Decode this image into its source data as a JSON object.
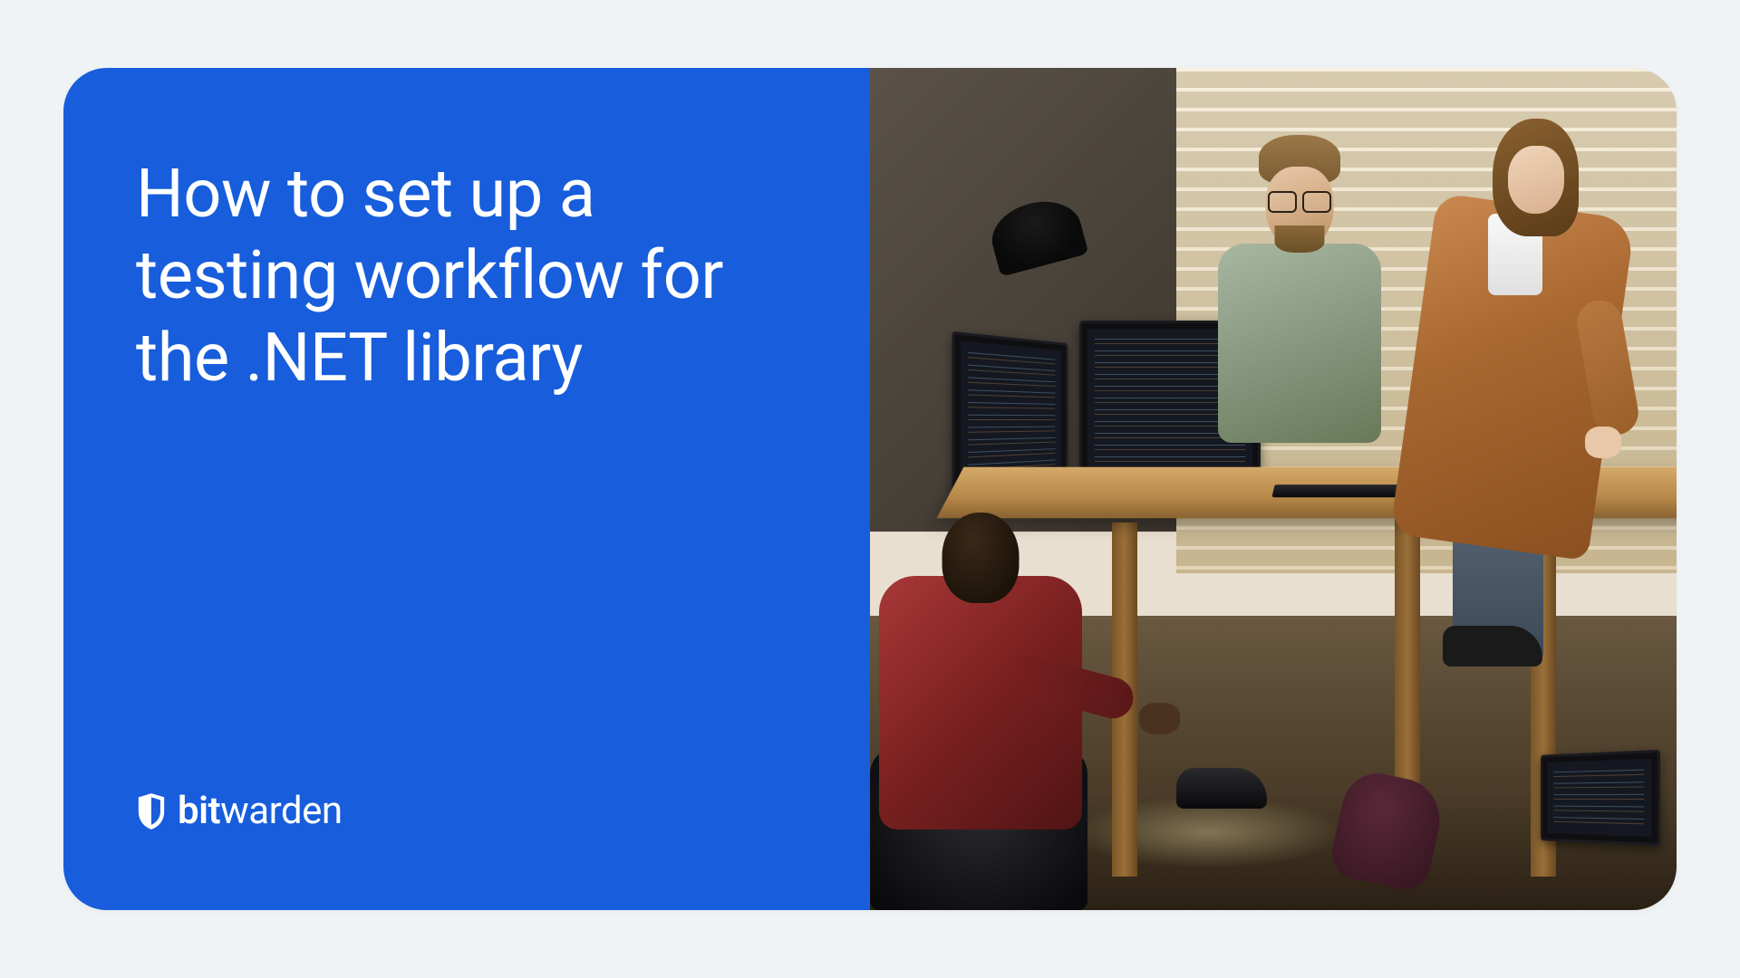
{
  "card": {
    "headline": "How to set up a testing workflow for the .NET library",
    "brand": {
      "bold_part": "bit",
      "light_part": "warden"
    }
  },
  "colors": {
    "panel_blue": "#175ddc",
    "page_bg": "#f0f3f6",
    "text_white": "#ffffff"
  },
  "image_description": "Office scene with three developers collaborating at a wooden desk with multiple monitors showing code, window with blinds in background"
}
